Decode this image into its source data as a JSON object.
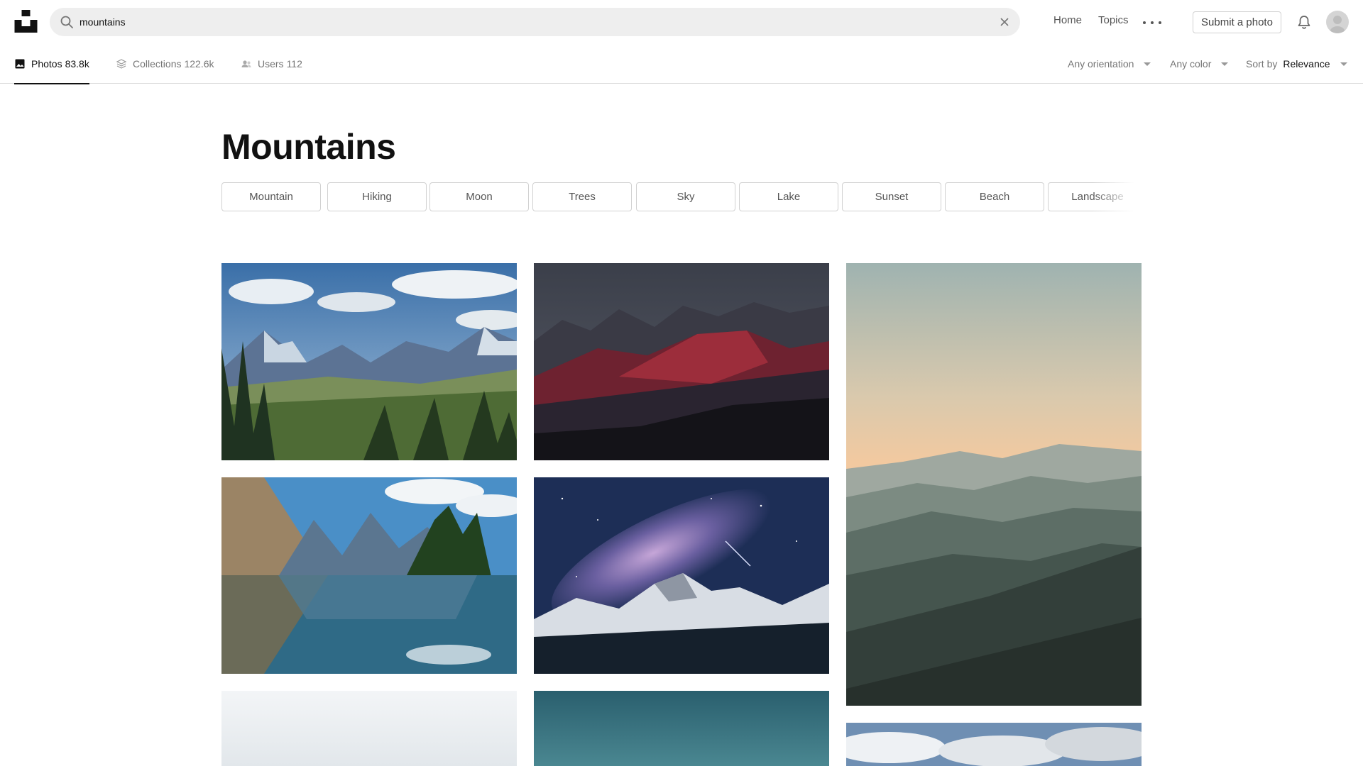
{
  "header": {
    "search_value": "mountains",
    "nav": {
      "home": "Home",
      "topics": "Topics"
    },
    "submit_label": "Submit a photo"
  },
  "subnav": {
    "tabs": [
      {
        "label": "Photos",
        "count": "83.8k"
      },
      {
        "label": "Collections",
        "count": "122.6k"
      },
      {
        "label": "Users",
        "count": "112"
      }
    ],
    "filters": {
      "orientation": "Any orientation",
      "color": "Any color",
      "sort_prefix": "Sort by",
      "sort_value": "Relevance"
    }
  },
  "page": {
    "title": "Mountains"
  },
  "tags": [
    "Mountain",
    "Hiking",
    "Moon",
    "Trees",
    "Sky",
    "Lake",
    "Sunset",
    "Beach",
    "Landscape"
  ],
  "icons": {
    "logo": "unsplash-logo-icon",
    "search": "search-icon",
    "clear": "close-icon",
    "more": "more-dots-icon",
    "bell": "bell-icon",
    "photos_tab": "image-icon",
    "collections_tab": "layers-icon",
    "users_tab": "users-icon"
  },
  "colors": {
    "accent": "#111111",
    "muted_text": "#767676",
    "search_bg": "#eeeeee"
  }
}
